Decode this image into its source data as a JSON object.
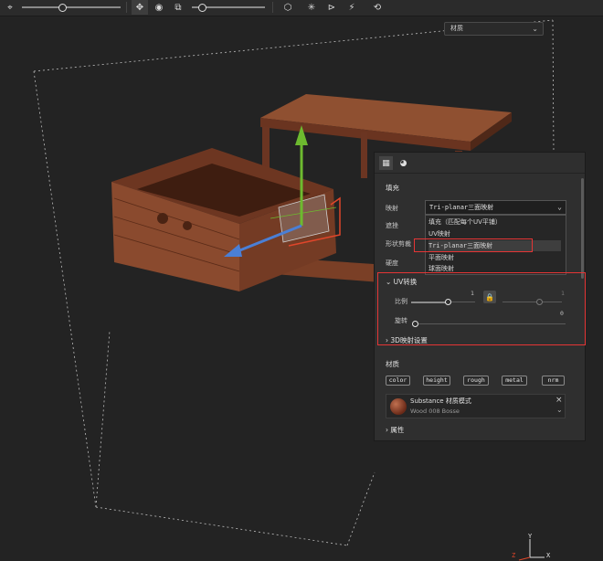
{
  "toolbar": {
    "icons": [
      "transform-icon",
      "move-icon",
      "target-icon",
      "scale-icon",
      "cube-icon",
      "light-icon",
      "symmetry-icon",
      "wand-icon",
      "history-icon"
    ]
  },
  "viewport": {
    "mode_dropdown": "材质"
  },
  "panel": {
    "tabs": [
      "layer-properties-icon",
      "material-ball-icon"
    ],
    "fill_section_title": "填充",
    "projection_label": "映射",
    "projection_value": "Tri-planar三面映射",
    "projection_options": [
      "填充（匹配每个UV平铺）",
      "UV映射",
      "Tri-planar三面映射",
      "平面映射",
      "球面映射"
    ],
    "selected_option_index": 2,
    "hidden_labels": [
      "遮挫",
      "形状剪裁",
      "硬度"
    ],
    "uv_transform": {
      "title": "UV转换",
      "scale_label": "比例",
      "scale_value": "1",
      "scale_value_right": "1",
      "rotation_label": "旋转",
      "rotation_value": "0",
      "scale_fraction": 0.72,
      "rotation_fraction": 0.0
    },
    "projection_3d_title": "3D映射设置",
    "material_section_title": "材质",
    "channels": [
      "color",
      "height",
      "rough",
      "metal",
      "nrm"
    ],
    "material": {
      "title": "Substance 材质模式",
      "name": "Wood 008 Bosse"
    },
    "properties_title": "属性"
  },
  "axis_gizmo": {
    "x": "X",
    "y": "Y",
    "z": "Z"
  },
  "colors": {
    "highlight_red": "#e53535",
    "wood": "#8a4a2e",
    "gizmo_y": "#6dba2f",
    "gizmo_x": "#e0462a",
    "gizmo_z": "#4a7fd6"
  }
}
